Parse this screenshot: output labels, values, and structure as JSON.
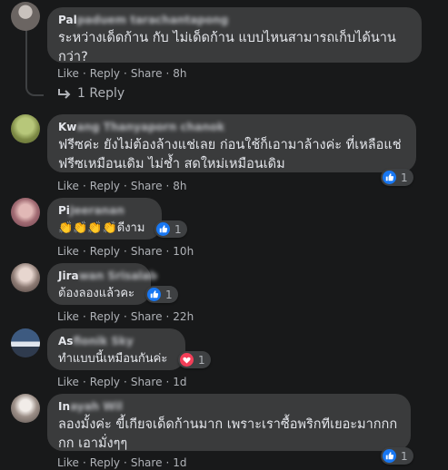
{
  "comments": [
    {
      "name_visible": "Pal",
      "name_blurred": "paduem tarachantapong",
      "text": "ระหว่างเด็ดก้าน กับ ไม่เด็ดก้าน แบบไหนสามารถเก็บได้นาน กว่า?",
      "like": "Like",
      "reply": "Reply",
      "share": "Share",
      "time": "8h",
      "reaction_count": ""
    },
    {
      "name_visible": "Kw",
      "name_blurred": "ang Thanyaporn chanok",
      "text": "ฟรีซค่ะ ยังไม่ต้องล้างแช่เลย ก่อนใช้ก็เอามาล้างค่ะ ที่เหลือแช่ฟรีซเหมือนเดิม ไม่ช้ำ สดใหม่เหมือนเดิม",
      "like": "Like",
      "reply": "Reply",
      "share": "Share",
      "time": "8h",
      "reaction_count": "1"
    },
    {
      "name_visible": "Pi",
      "name_blurred": "Jeeranan",
      "text": "👏👏👏👏ดีงาม",
      "like": "Like",
      "reply": "Reply",
      "share": "Share",
      "time": "10h",
      "reaction_count": "1"
    },
    {
      "name_visible": "Jira",
      "name_blurred": "wan Srisalab",
      "text": "ต้องลองแล้วคะ",
      "like": "Like",
      "reply": "Reply",
      "share": "Share",
      "time": "22h",
      "reaction_count": "1"
    },
    {
      "name_visible": "As",
      "name_blurred": "fionik Sky",
      "text": "ทำแบบนี้เหมือนกันค่ะ",
      "like": "Like",
      "reply": "Reply",
      "share": "Share",
      "time": "1d",
      "reaction_count": "1"
    },
    {
      "name_visible": "In",
      "name_blurred": "ayah Wil",
      "text": "ลองมั้งค่ะ ขี้เกียจเด็ดก้านมาก เพราะเราซื้อพริกทีเยอะมากกกกก เอามั่งๆๆ",
      "like": "Like",
      "reply": "Reply",
      "share": "Share",
      "time": "1d",
      "reaction_count": "1"
    }
  ],
  "view_replies": "1 Reply",
  "colors": {
    "like": "#1877f2",
    "love": "#f33e58",
    "bubble": "#3a3b3c",
    "background": "#18191a"
  },
  "icons": {
    "reply_arrow": "reply-arrow-icon",
    "like": "like-reaction-icon",
    "love": "love-reaction-icon"
  }
}
